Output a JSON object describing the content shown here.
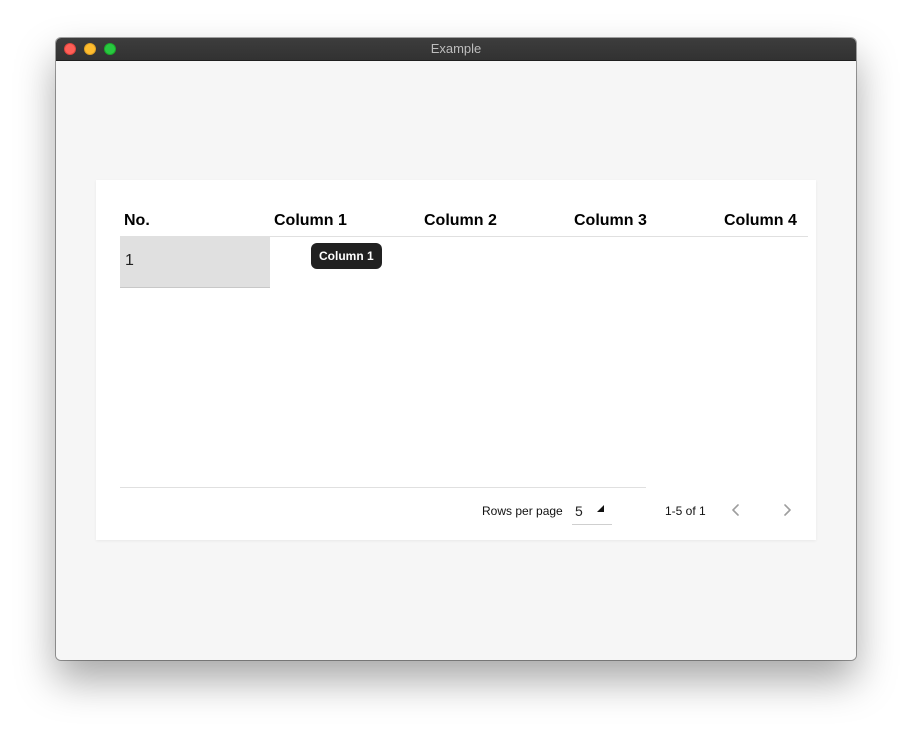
{
  "window": {
    "title": "Example"
  },
  "table": {
    "columns": [
      "No.",
      "Column 1",
      "Column 2",
      "Column 3",
      "Column 4"
    ],
    "rows": [
      {
        "no": "1"
      }
    ],
    "tooltip": "Column 1"
  },
  "pagination": {
    "rows_per_page_label": "Rows per page",
    "rows_per_page_value": "5",
    "range_text": "1-5 of 1",
    "prev_icon": "chevron-left-icon",
    "next_icon": "chevron-right-icon"
  }
}
